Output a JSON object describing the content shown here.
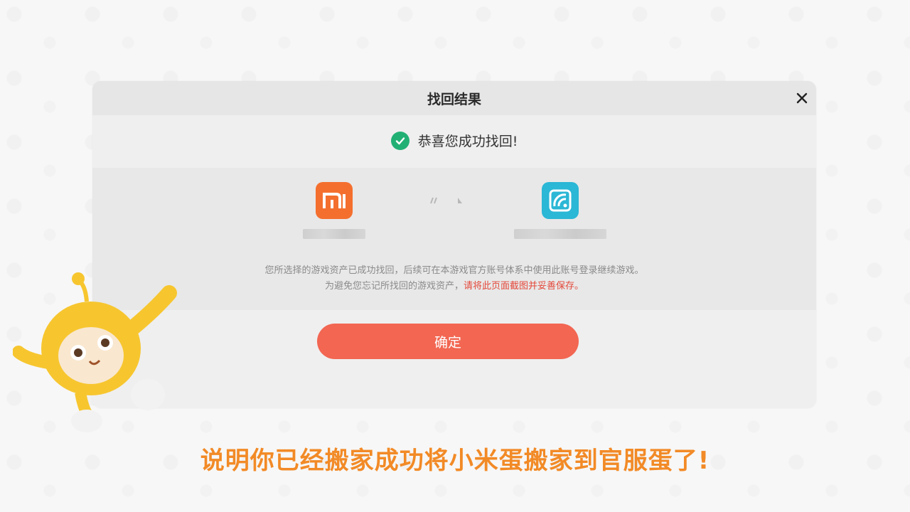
{
  "dialog": {
    "title": "找回结果",
    "success_message": "恭喜您成功找回!",
    "source_account": {
      "app": "Xiaomi",
      "logo_text": "mi",
      "brand_color": "#f46f2e"
    },
    "target_account": {
      "app": "official",
      "brand_color": "#2bb7d6"
    },
    "info_line1": "您所选择的游戏资产已成功找回，后续可在本游戏官方账号体系中使用此账号登录继续游戏。",
    "info_line2_prefix": "为避免您忘记所找回的游戏资产，",
    "info_line2_highlight": "请将此页面截图并妥善保存。",
    "confirm_label": "确定"
  },
  "caption": "说明你已经搬家成功将小米蛋搬家到官服蛋了!",
  "icons": {
    "close": "close-icon",
    "check": "check-circle-icon",
    "arrow": "arrow-right-icon",
    "mascot": "mascot-character"
  },
  "colors": {
    "accent": "#f26652",
    "success": "#21b074",
    "caption": "#f28a26",
    "highlight": "#e4493b"
  }
}
